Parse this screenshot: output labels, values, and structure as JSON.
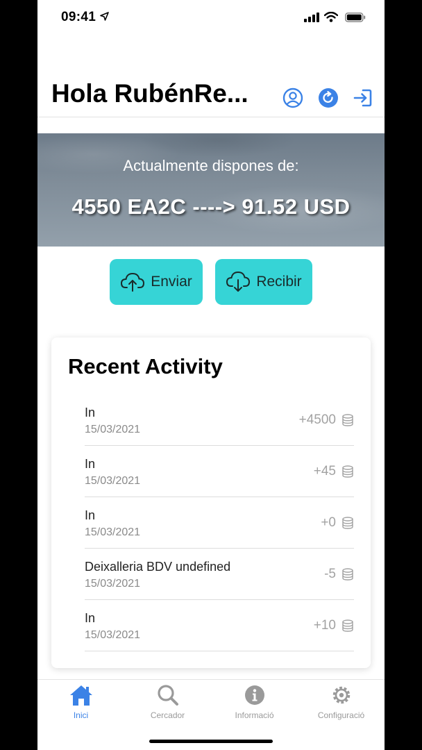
{
  "status_bar": {
    "time": "09:41"
  },
  "header": {
    "greeting": "Hola RubénRe..."
  },
  "balance": {
    "label": "Actualmente dispones de:",
    "amount": "4550 EA2C ----> 91.52 USD"
  },
  "actions": {
    "send_label": "Enviar",
    "receive_label": "Recibir"
  },
  "activity": {
    "title": "Recent Activity",
    "items": [
      {
        "title": "In",
        "date": "15/03/2021",
        "amount": "+4500"
      },
      {
        "title": "In",
        "date": "15/03/2021",
        "amount": "+45"
      },
      {
        "title": "In",
        "date": "15/03/2021",
        "amount": "+0"
      },
      {
        "title": "Deixalleria BDV undefined",
        "date": "15/03/2021",
        "amount": "-5"
      },
      {
        "title": "In",
        "date": "15/03/2021",
        "amount": "+10"
      }
    ]
  },
  "tabs": [
    {
      "label": "Inici",
      "icon": "home-icon",
      "active": true
    },
    {
      "label": "Cercador",
      "icon": "search-icon",
      "active": false
    },
    {
      "label": "Informació",
      "icon": "info-icon",
      "active": false
    },
    {
      "label": "Configuració",
      "icon": "gear-icon",
      "active": false
    }
  ],
  "colors": {
    "accent": "#36d4d6",
    "header_icons": "#3b82e6",
    "tab_active": "#3b82e6",
    "tab_inactive": "#9a9a9a"
  }
}
